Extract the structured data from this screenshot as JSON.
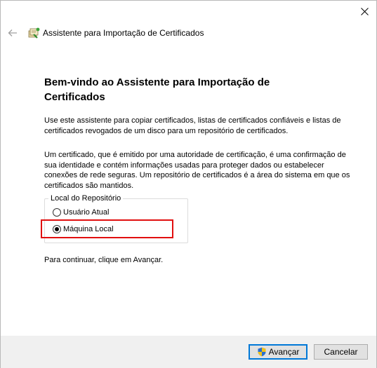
{
  "window": {
    "close_icon": "close-icon"
  },
  "header": {
    "back_icon": "back-arrow-icon",
    "wizard_icon": "certificate-wizard-icon",
    "title": "Assistente para Importação de Certificados"
  },
  "main": {
    "heading": "Bem-vindo ao Assistente para Importação de Certificados",
    "paragraph1": "Use este assistente para copiar certificados, listas de certificados confiáveis e listas de certificados revogados de um disco para um repositório de certificados.",
    "paragraph2": "Um certificado, que é emitido por uma autoridade de certificação, é uma confirmação de sua identidade e contém informações usadas para proteger dados ou estabelecer conexões de rede seguras. Um repositório de certificados é a área do sistema em que os certificados são mantidos.",
    "store_group": {
      "label": "Local do Repositório",
      "options": [
        {
          "label": "Usuário Atual",
          "selected": false
        },
        {
          "label": "Máquina Local",
          "selected": true
        }
      ]
    },
    "continue_text": "Para continuar, clique em Avançar."
  },
  "footer": {
    "next_label": "Avançar",
    "next_icon": "uac-shield-icon",
    "cancel_label": "Cancelar"
  },
  "colors": {
    "highlight": "#e10f0f",
    "focus_border": "#0078d7",
    "footer_bg": "#f0f0f0"
  }
}
